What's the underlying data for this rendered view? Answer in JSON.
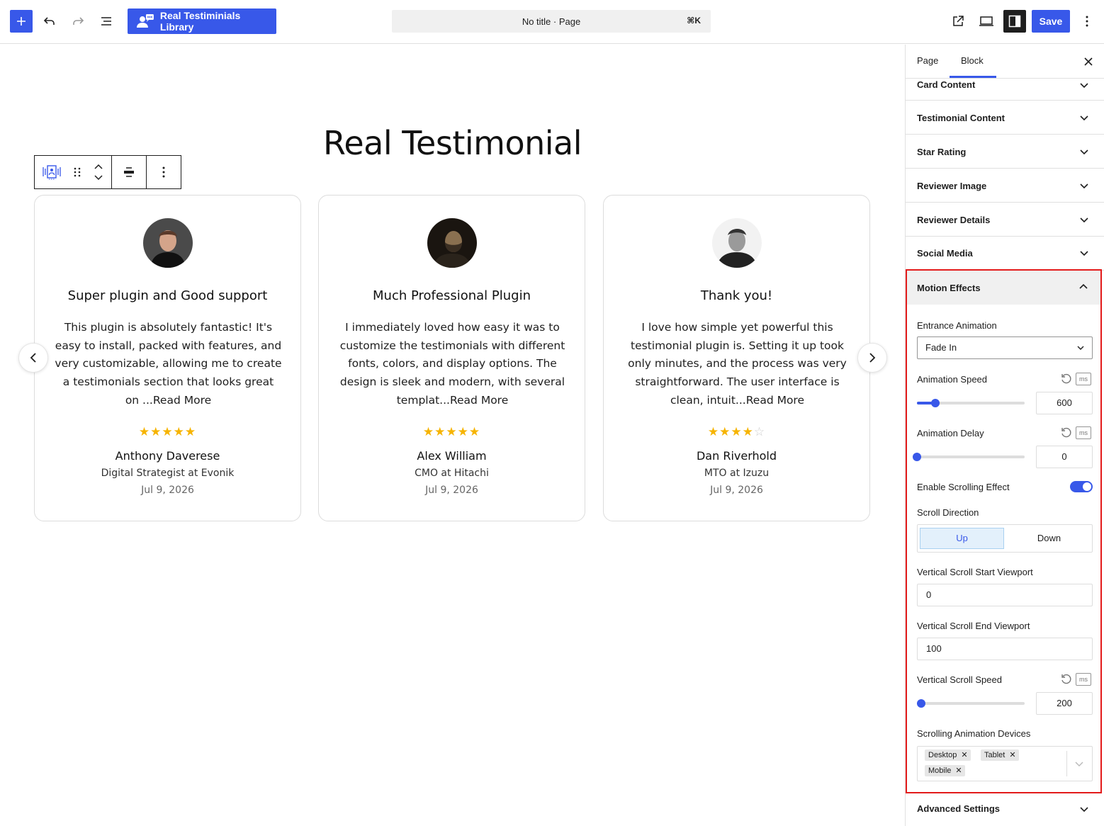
{
  "toolbar": {
    "library_label": "Real Testiminials Library",
    "command_text": "No title · Page",
    "command_shortcut": "⌘K",
    "save_label": "Save",
    "icons": [
      "plus-icon",
      "undo-icon",
      "redo-icon",
      "list-view-icon",
      "external-link-icon",
      "device-preview-icon",
      "sidebar-toggle-icon",
      "more-vertical-icon"
    ]
  },
  "canvas": {
    "heading": "Real Testimonial",
    "cards": [
      {
        "title": "Super plugin and Good support",
        "text": "This plugin is absolutely fantastic! It's easy to install, packed with features, and very customizable, allowing me to create a testimonials section that looks great on ...Read More",
        "rating": 5,
        "stars": "★★★★★",
        "stars_empty": "",
        "name": "Anthony Daverese",
        "role": "Digital Strategist at Evonik",
        "date": "Jul 9, 2026"
      },
      {
        "title": "Much Professional Plugin",
        "text": "I immediately loved how easy it was to customize the testimonials with different fonts, colors, and display options. The design is sleek and modern, with several templat...Read More",
        "rating": 5,
        "stars": "★★★★★",
        "stars_empty": "",
        "name": "Alex William",
        "role": "CMO at Hitachi",
        "date": "Jul 9, 2026"
      },
      {
        "title": "Thank you!",
        "text": "I love how simple yet powerful this testimonial plugin is. Setting it up took only minutes, and the process was very straightforward. The user interface is clean, intuit...Read More",
        "rating": 4,
        "stars": "★★★★",
        "stars_empty": "☆",
        "name": "Dan Riverhold",
        "role": "MTO at Izuzu",
        "date": "Jul 9, 2026"
      }
    ]
  },
  "sidebar": {
    "tabs": [
      "Page",
      "Block"
    ],
    "active_tab": "Block",
    "panels": [
      "Card Content",
      "Testimonial Content",
      "Star Rating",
      "Reviewer Image",
      "Reviewer Details",
      "Social Media"
    ],
    "motion": {
      "title": "Motion Effects",
      "entrance_label": "Entrance Animation",
      "entrance_value": "Fade In",
      "speed_label": "Animation Speed",
      "speed_value": "600",
      "speed_fraction": 0.17,
      "unit": "ms",
      "delay_label": "Animation Delay",
      "delay_value": "0",
      "delay_fraction": 0,
      "scroll_effect_label": "Enable Scrolling Effect",
      "scroll_effect_on": true,
      "direction_label": "Scroll Direction",
      "direction_up": "Up",
      "direction_down": "Down",
      "direction_selected": "Up",
      "start_label": "Vertical Scroll Start Viewport",
      "start_value": "0",
      "end_label": "Vertical Scroll End Viewport",
      "end_value": "100",
      "vspeed_label": "Vertical Scroll Speed",
      "vspeed_value": "200",
      "vspeed_fraction": 0.04,
      "devices_label": "Scrolling Animation Devices",
      "devices": [
        "Desktop",
        "Tablet",
        "Mobile"
      ]
    },
    "advanced": "Advanced Settings"
  },
  "colors": {
    "accent": "#3858e9",
    "highlight_border": "#e31b1b",
    "star": "#f6b400"
  }
}
